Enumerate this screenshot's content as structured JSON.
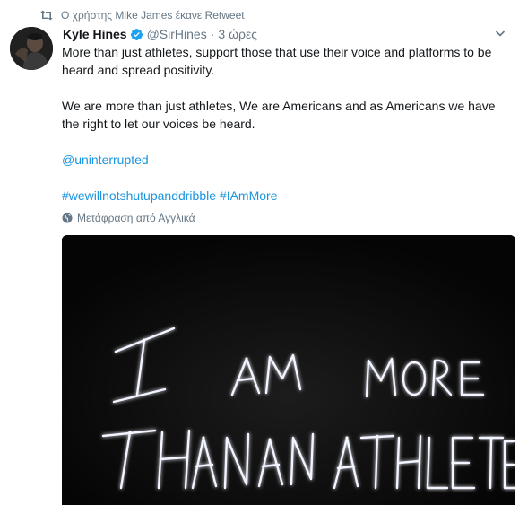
{
  "retweet_context": {
    "text": "Ο χρήστης Mike James έκανε Retweet"
  },
  "tweet": {
    "fullname": "Kyle Hines",
    "screenname": "@SirHines",
    "separator": "·",
    "time": "3 ώρες",
    "paragraph1": "More than just athletes, support those that use their voice and platforms to be heard and spread positivity.",
    "paragraph2": "We are more than just athletes, We are Americans and as Americans we have the right to let our voices be heard.",
    "mention": "@uninterrupted",
    "hashtag1": "#wewillnotshutupanddribble",
    "hashtag2": "#IAmMore",
    "translate_label": "Μετάφραση από Αγγλικά"
  },
  "media": {
    "neon_text": "I AM MORE THAN AN ATHLETE"
  },
  "colors": {
    "link": "#1b95e0",
    "secondary_text": "#657786",
    "verified": "#1da1f2"
  }
}
